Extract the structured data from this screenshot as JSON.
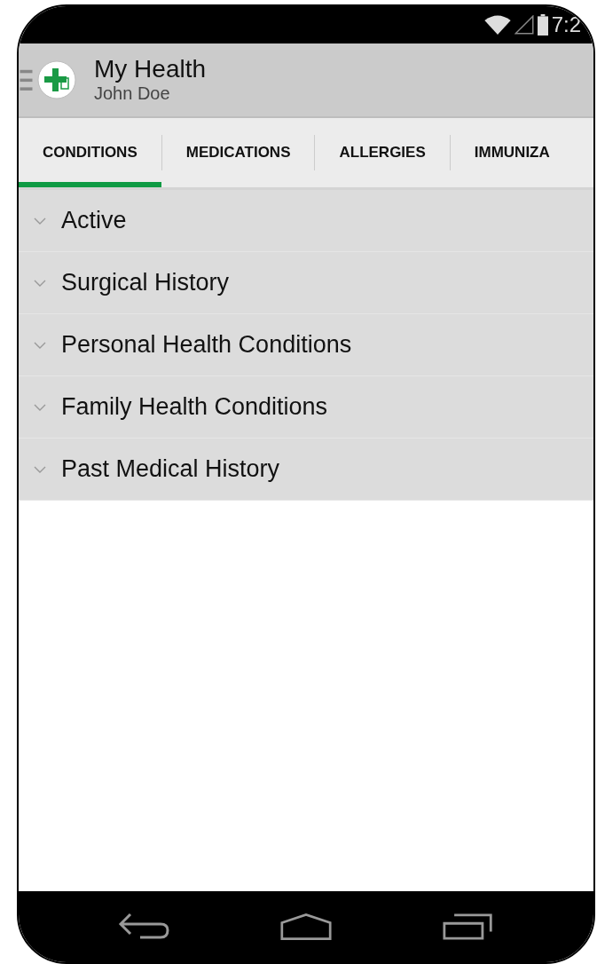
{
  "status_bar": {
    "time": "7:2"
  },
  "app_bar": {
    "title": "My Health",
    "subtitle": "John Doe"
  },
  "tabs": [
    {
      "label": "CONDITIONS",
      "selected": true
    },
    {
      "label": "MEDICATIONS",
      "selected": false
    },
    {
      "label": "ALLERGIES",
      "selected": false
    },
    {
      "label": "IMMUNIZA",
      "selected": false
    }
  ],
  "sections": [
    {
      "label": "Active",
      "expanded": false
    },
    {
      "label": "Surgical History",
      "expanded": false
    },
    {
      "label": "Personal Health Conditions",
      "expanded": false
    },
    {
      "label": "Family Health Conditions",
      "expanded": false
    },
    {
      "label": "Past Medical History",
      "expanded": false
    }
  ]
}
